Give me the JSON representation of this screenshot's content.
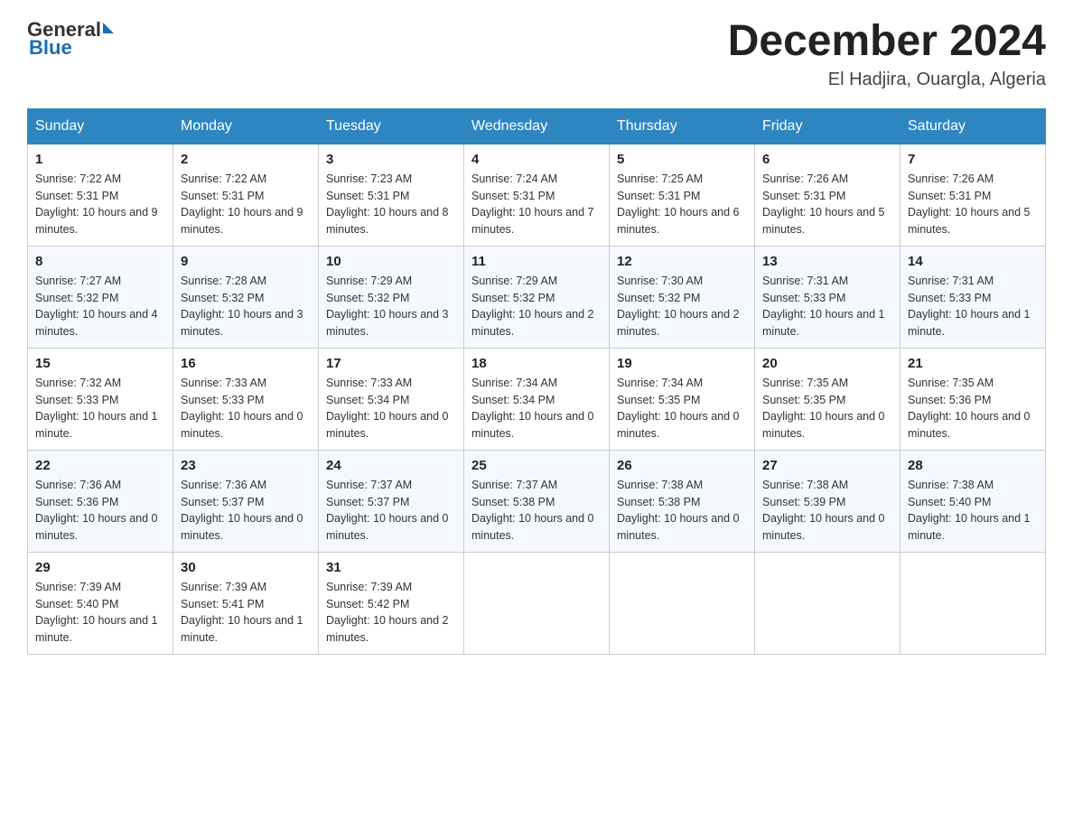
{
  "header": {
    "logo": {
      "general": "General",
      "blue": "Blue",
      "underline": "Blue"
    },
    "title": "December 2024",
    "location": "El Hadjira, Ouargla, Algeria"
  },
  "days_of_week": [
    "Sunday",
    "Monday",
    "Tuesday",
    "Wednesday",
    "Thursday",
    "Friday",
    "Saturday"
  ],
  "weeks": [
    [
      {
        "day": "1",
        "sunrise": "7:22 AM",
        "sunset": "5:31 PM",
        "daylight": "10 hours and 9 minutes."
      },
      {
        "day": "2",
        "sunrise": "7:22 AM",
        "sunset": "5:31 PM",
        "daylight": "10 hours and 9 minutes."
      },
      {
        "day": "3",
        "sunrise": "7:23 AM",
        "sunset": "5:31 PM",
        "daylight": "10 hours and 8 minutes."
      },
      {
        "day": "4",
        "sunrise": "7:24 AM",
        "sunset": "5:31 PM",
        "daylight": "10 hours and 7 minutes."
      },
      {
        "day": "5",
        "sunrise": "7:25 AM",
        "sunset": "5:31 PM",
        "daylight": "10 hours and 6 minutes."
      },
      {
        "day": "6",
        "sunrise": "7:26 AM",
        "sunset": "5:31 PM",
        "daylight": "10 hours and 5 minutes."
      },
      {
        "day": "7",
        "sunrise": "7:26 AM",
        "sunset": "5:31 PM",
        "daylight": "10 hours and 5 minutes."
      }
    ],
    [
      {
        "day": "8",
        "sunrise": "7:27 AM",
        "sunset": "5:32 PM",
        "daylight": "10 hours and 4 minutes."
      },
      {
        "day": "9",
        "sunrise": "7:28 AM",
        "sunset": "5:32 PM",
        "daylight": "10 hours and 3 minutes."
      },
      {
        "day": "10",
        "sunrise": "7:29 AM",
        "sunset": "5:32 PM",
        "daylight": "10 hours and 3 minutes."
      },
      {
        "day": "11",
        "sunrise": "7:29 AM",
        "sunset": "5:32 PM",
        "daylight": "10 hours and 2 minutes."
      },
      {
        "day": "12",
        "sunrise": "7:30 AM",
        "sunset": "5:32 PM",
        "daylight": "10 hours and 2 minutes."
      },
      {
        "day": "13",
        "sunrise": "7:31 AM",
        "sunset": "5:33 PM",
        "daylight": "10 hours and 1 minute."
      },
      {
        "day": "14",
        "sunrise": "7:31 AM",
        "sunset": "5:33 PM",
        "daylight": "10 hours and 1 minute."
      }
    ],
    [
      {
        "day": "15",
        "sunrise": "7:32 AM",
        "sunset": "5:33 PM",
        "daylight": "10 hours and 1 minute."
      },
      {
        "day": "16",
        "sunrise": "7:33 AM",
        "sunset": "5:33 PM",
        "daylight": "10 hours and 0 minutes."
      },
      {
        "day": "17",
        "sunrise": "7:33 AM",
        "sunset": "5:34 PM",
        "daylight": "10 hours and 0 minutes."
      },
      {
        "day": "18",
        "sunrise": "7:34 AM",
        "sunset": "5:34 PM",
        "daylight": "10 hours and 0 minutes."
      },
      {
        "day": "19",
        "sunrise": "7:34 AM",
        "sunset": "5:35 PM",
        "daylight": "10 hours and 0 minutes."
      },
      {
        "day": "20",
        "sunrise": "7:35 AM",
        "sunset": "5:35 PM",
        "daylight": "10 hours and 0 minutes."
      },
      {
        "day": "21",
        "sunrise": "7:35 AM",
        "sunset": "5:36 PM",
        "daylight": "10 hours and 0 minutes."
      }
    ],
    [
      {
        "day": "22",
        "sunrise": "7:36 AM",
        "sunset": "5:36 PM",
        "daylight": "10 hours and 0 minutes."
      },
      {
        "day": "23",
        "sunrise": "7:36 AM",
        "sunset": "5:37 PM",
        "daylight": "10 hours and 0 minutes."
      },
      {
        "day": "24",
        "sunrise": "7:37 AM",
        "sunset": "5:37 PM",
        "daylight": "10 hours and 0 minutes."
      },
      {
        "day": "25",
        "sunrise": "7:37 AM",
        "sunset": "5:38 PM",
        "daylight": "10 hours and 0 minutes."
      },
      {
        "day": "26",
        "sunrise": "7:38 AM",
        "sunset": "5:38 PM",
        "daylight": "10 hours and 0 minutes."
      },
      {
        "day": "27",
        "sunrise": "7:38 AM",
        "sunset": "5:39 PM",
        "daylight": "10 hours and 0 minutes."
      },
      {
        "day": "28",
        "sunrise": "7:38 AM",
        "sunset": "5:40 PM",
        "daylight": "10 hours and 1 minute."
      }
    ],
    [
      {
        "day": "29",
        "sunrise": "7:39 AM",
        "sunset": "5:40 PM",
        "daylight": "10 hours and 1 minute."
      },
      {
        "day": "30",
        "sunrise": "7:39 AM",
        "sunset": "5:41 PM",
        "daylight": "10 hours and 1 minute."
      },
      {
        "day": "31",
        "sunrise": "7:39 AM",
        "sunset": "5:42 PM",
        "daylight": "10 hours and 2 minutes."
      },
      null,
      null,
      null,
      null
    ]
  ],
  "labels": {
    "sunrise": "Sunrise:",
    "sunset": "Sunset:",
    "daylight": "Daylight:"
  }
}
